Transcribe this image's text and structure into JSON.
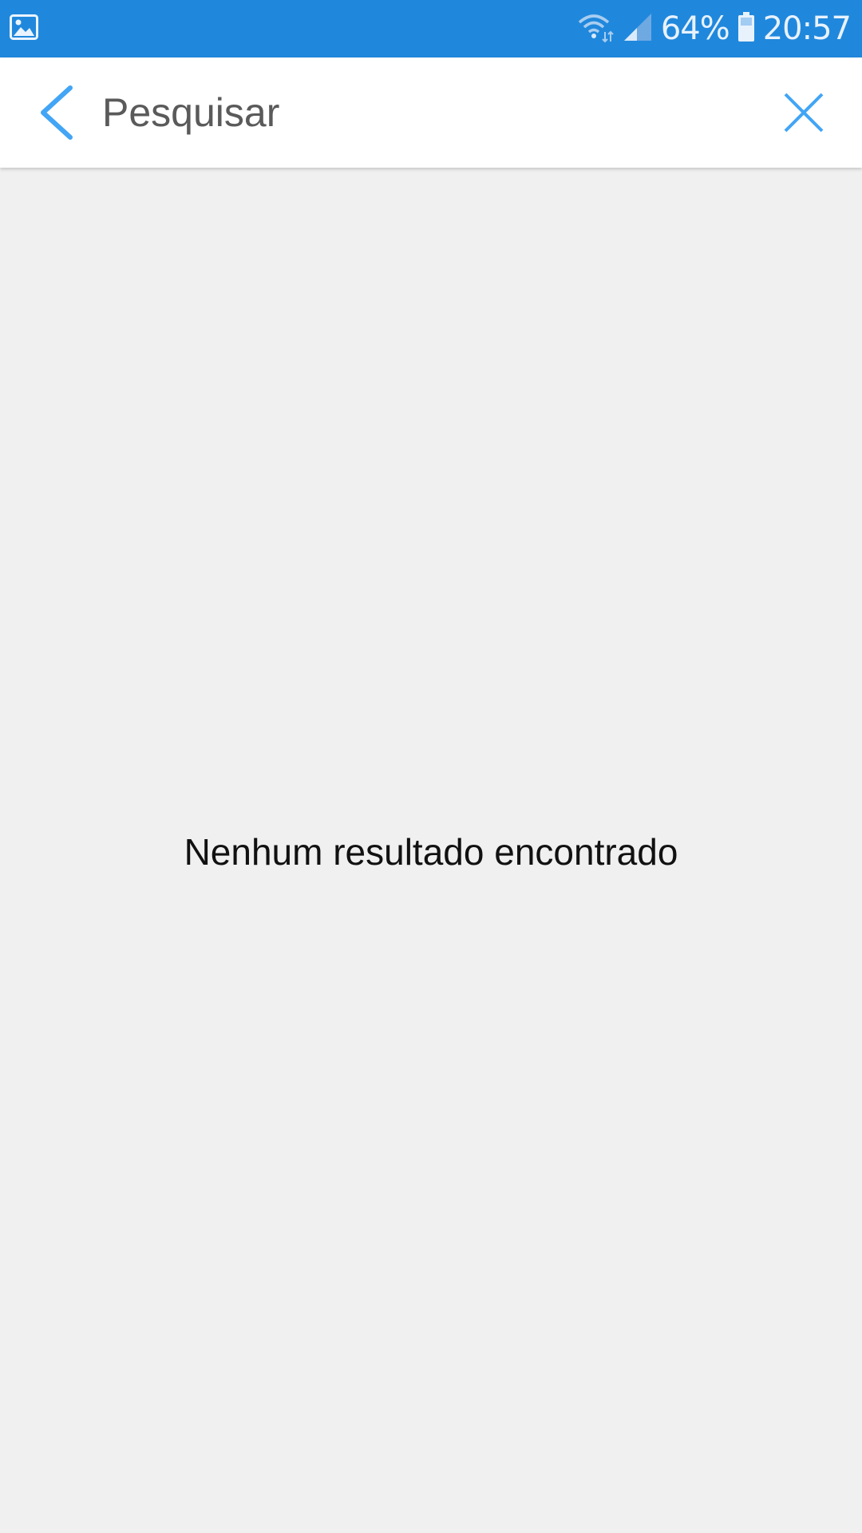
{
  "status_bar": {
    "battery_percent": "64%",
    "time": "20:57",
    "icons": [
      "gallery-notification-icon",
      "wifi-icon",
      "signal-icon",
      "battery-icon"
    ]
  },
  "search": {
    "placeholder": "Pesquisar",
    "value": ""
  },
  "results": {
    "empty_message": "Nenhum resultado encontrado"
  },
  "colors": {
    "status_bar_bg": "#2088dc",
    "accent": "#42a5f5",
    "background": "#f0f0f0"
  }
}
